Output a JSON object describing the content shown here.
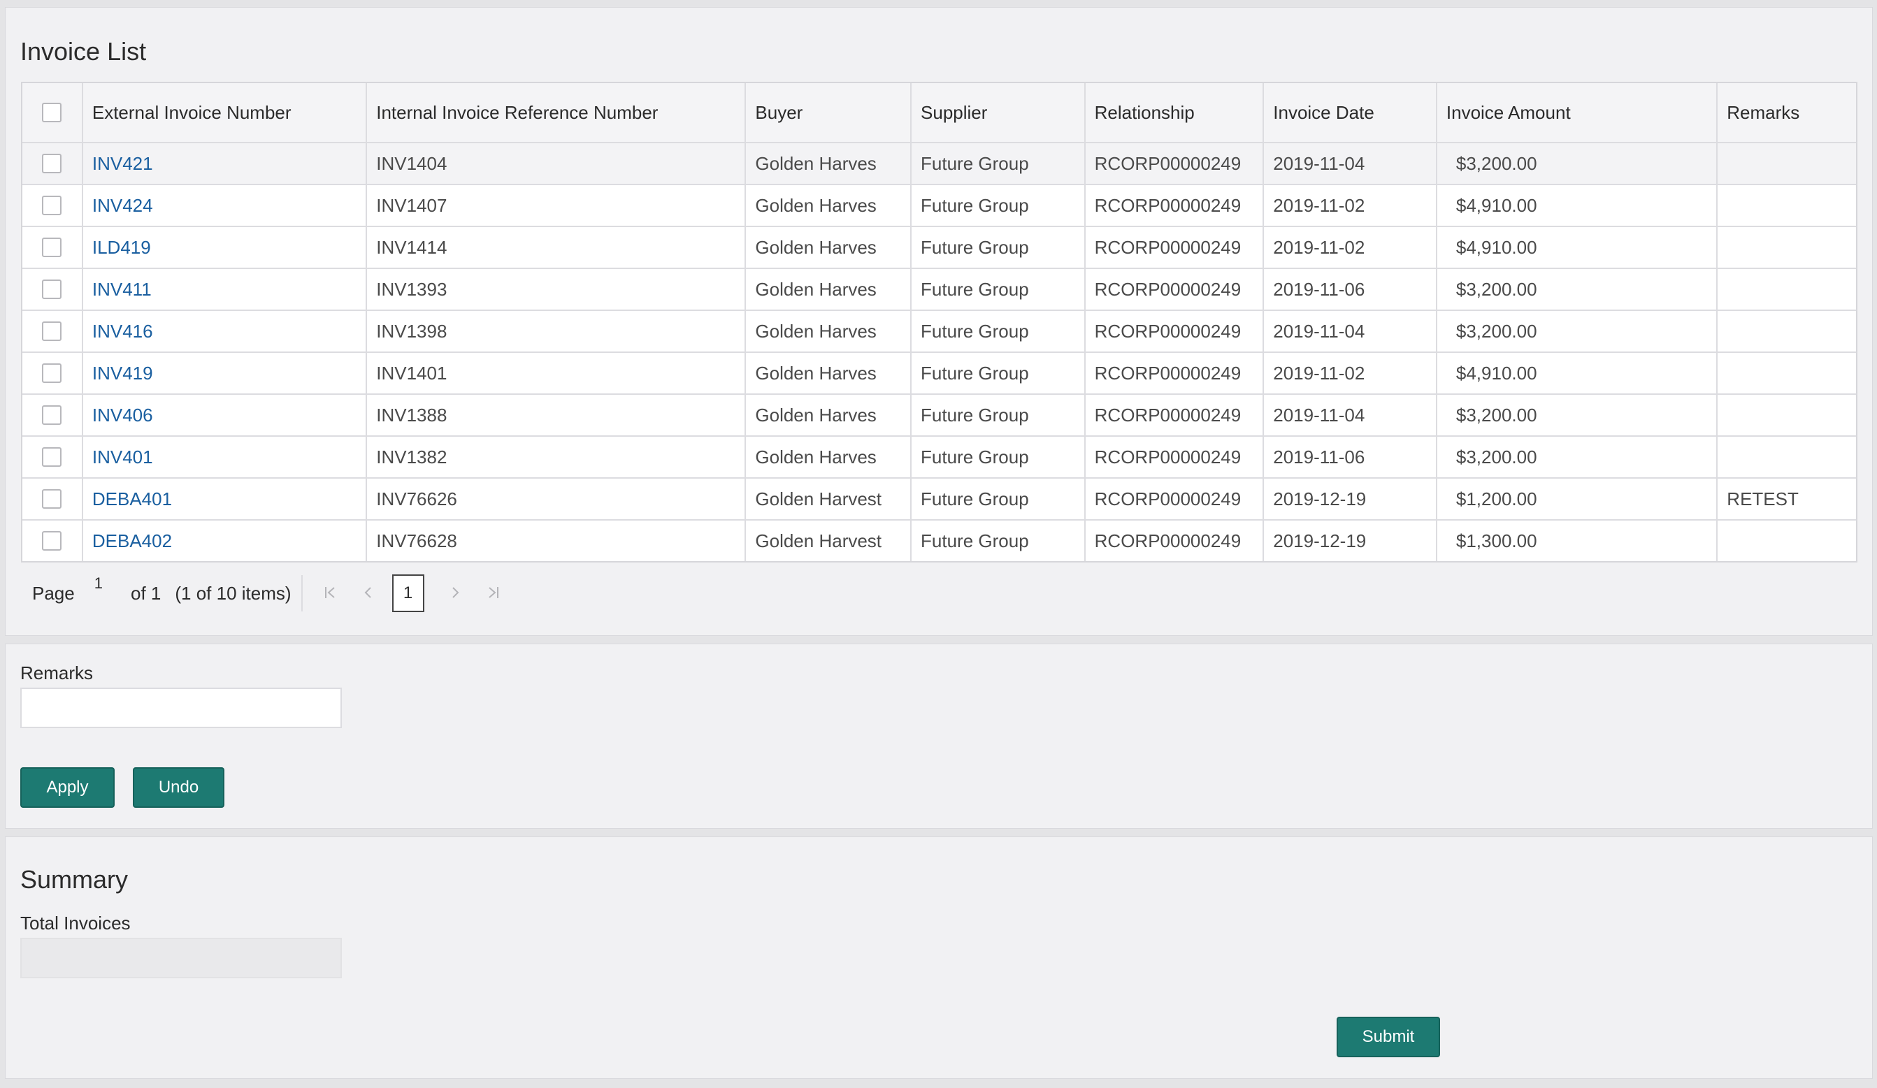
{
  "invoice_list": {
    "title": "Invoice List",
    "columns": [
      "External Invoice Number",
      "Internal Invoice Reference Number",
      "Buyer",
      "Supplier",
      "Relationship",
      "Invoice Date",
      "Invoice Amount",
      "Remarks"
    ],
    "rows": [
      {
        "external": "INV421",
        "internal": "INV1404",
        "buyer": "Golden Harves",
        "supplier": "Future Group",
        "relationship": "RCORP00000249",
        "date": "2019-11-04",
        "amount": "$3,200.00",
        "remarks": ""
      },
      {
        "external": "INV424",
        "internal": "INV1407",
        "buyer": "Golden Harves",
        "supplier": "Future Group",
        "relationship": "RCORP00000249",
        "date": "2019-11-02",
        "amount": "$4,910.00",
        "remarks": ""
      },
      {
        "external": "ILD419",
        "internal": "INV1414",
        "buyer": "Golden Harves",
        "supplier": "Future Group",
        "relationship": "RCORP00000249",
        "date": "2019-11-02",
        "amount": "$4,910.00",
        "remarks": ""
      },
      {
        "external": "INV411",
        "internal": "INV1393",
        "buyer": "Golden Harves",
        "supplier": "Future Group",
        "relationship": "RCORP00000249",
        "date": "2019-11-06",
        "amount": "$3,200.00",
        "remarks": ""
      },
      {
        "external": "INV416",
        "internal": "INV1398",
        "buyer": "Golden Harves",
        "supplier": "Future Group",
        "relationship": "RCORP00000249",
        "date": "2019-11-04",
        "amount": "$3,200.00",
        "remarks": ""
      },
      {
        "external": "INV419",
        "internal": "INV1401",
        "buyer": "Golden Harves",
        "supplier": "Future Group",
        "relationship": "RCORP00000249",
        "date": "2019-11-02",
        "amount": "$4,910.00",
        "remarks": ""
      },
      {
        "external": "INV406",
        "internal": "INV1388",
        "buyer": "Golden Harves",
        "supplier": "Future Group",
        "relationship": "RCORP00000249",
        "date": "2019-11-04",
        "amount": "$3,200.00",
        "remarks": ""
      },
      {
        "external": "INV401",
        "internal": "INV1382",
        "buyer": "Golden Harves",
        "supplier": "Future Group",
        "relationship": "RCORP00000249",
        "date": "2019-11-06",
        "amount": "$3,200.00",
        "remarks": ""
      },
      {
        "external": "DEBA401",
        "internal": "INV76626",
        "buyer": "Golden Harvest",
        "supplier": "Future Group",
        "relationship": "RCORP00000249",
        "date": "2019-12-19",
        "amount": "$1,200.00",
        "remarks": "RETEST"
      },
      {
        "external": "DEBA402",
        "internal": "INV76628",
        "buyer": "Golden Harvest",
        "supplier": "Future Group",
        "relationship": "RCORP00000249",
        "date": "2019-12-19",
        "amount": "$1,300.00",
        "remarks": ""
      }
    ]
  },
  "pager": {
    "page_label": "Page",
    "page_input": "1",
    "of_total": "of 1",
    "item_count": "(1 of 10 items)",
    "current_page": "1",
    "first_icon": "first-page-icon",
    "prev_icon": "prev-page-icon",
    "next_icon": "next-page-icon",
    "last_icon": "last-page-icon"
  },
  "remarks_section": {
    "label": "Remarks",
    "value": "",
    "apply_label": "Apply",
    "undo_label": "Undo"
  },
  "summary": {
    "title": "Summary",
    "total_label": "Total Invoices",
    "total_value": "",
    "submit_label": "Submit"
  },
  "colors": {
    "accent": "#1d7a72",
    "link": "#1a5fa0",
    "panel_bg": "#f1f1f3"
  }
}
